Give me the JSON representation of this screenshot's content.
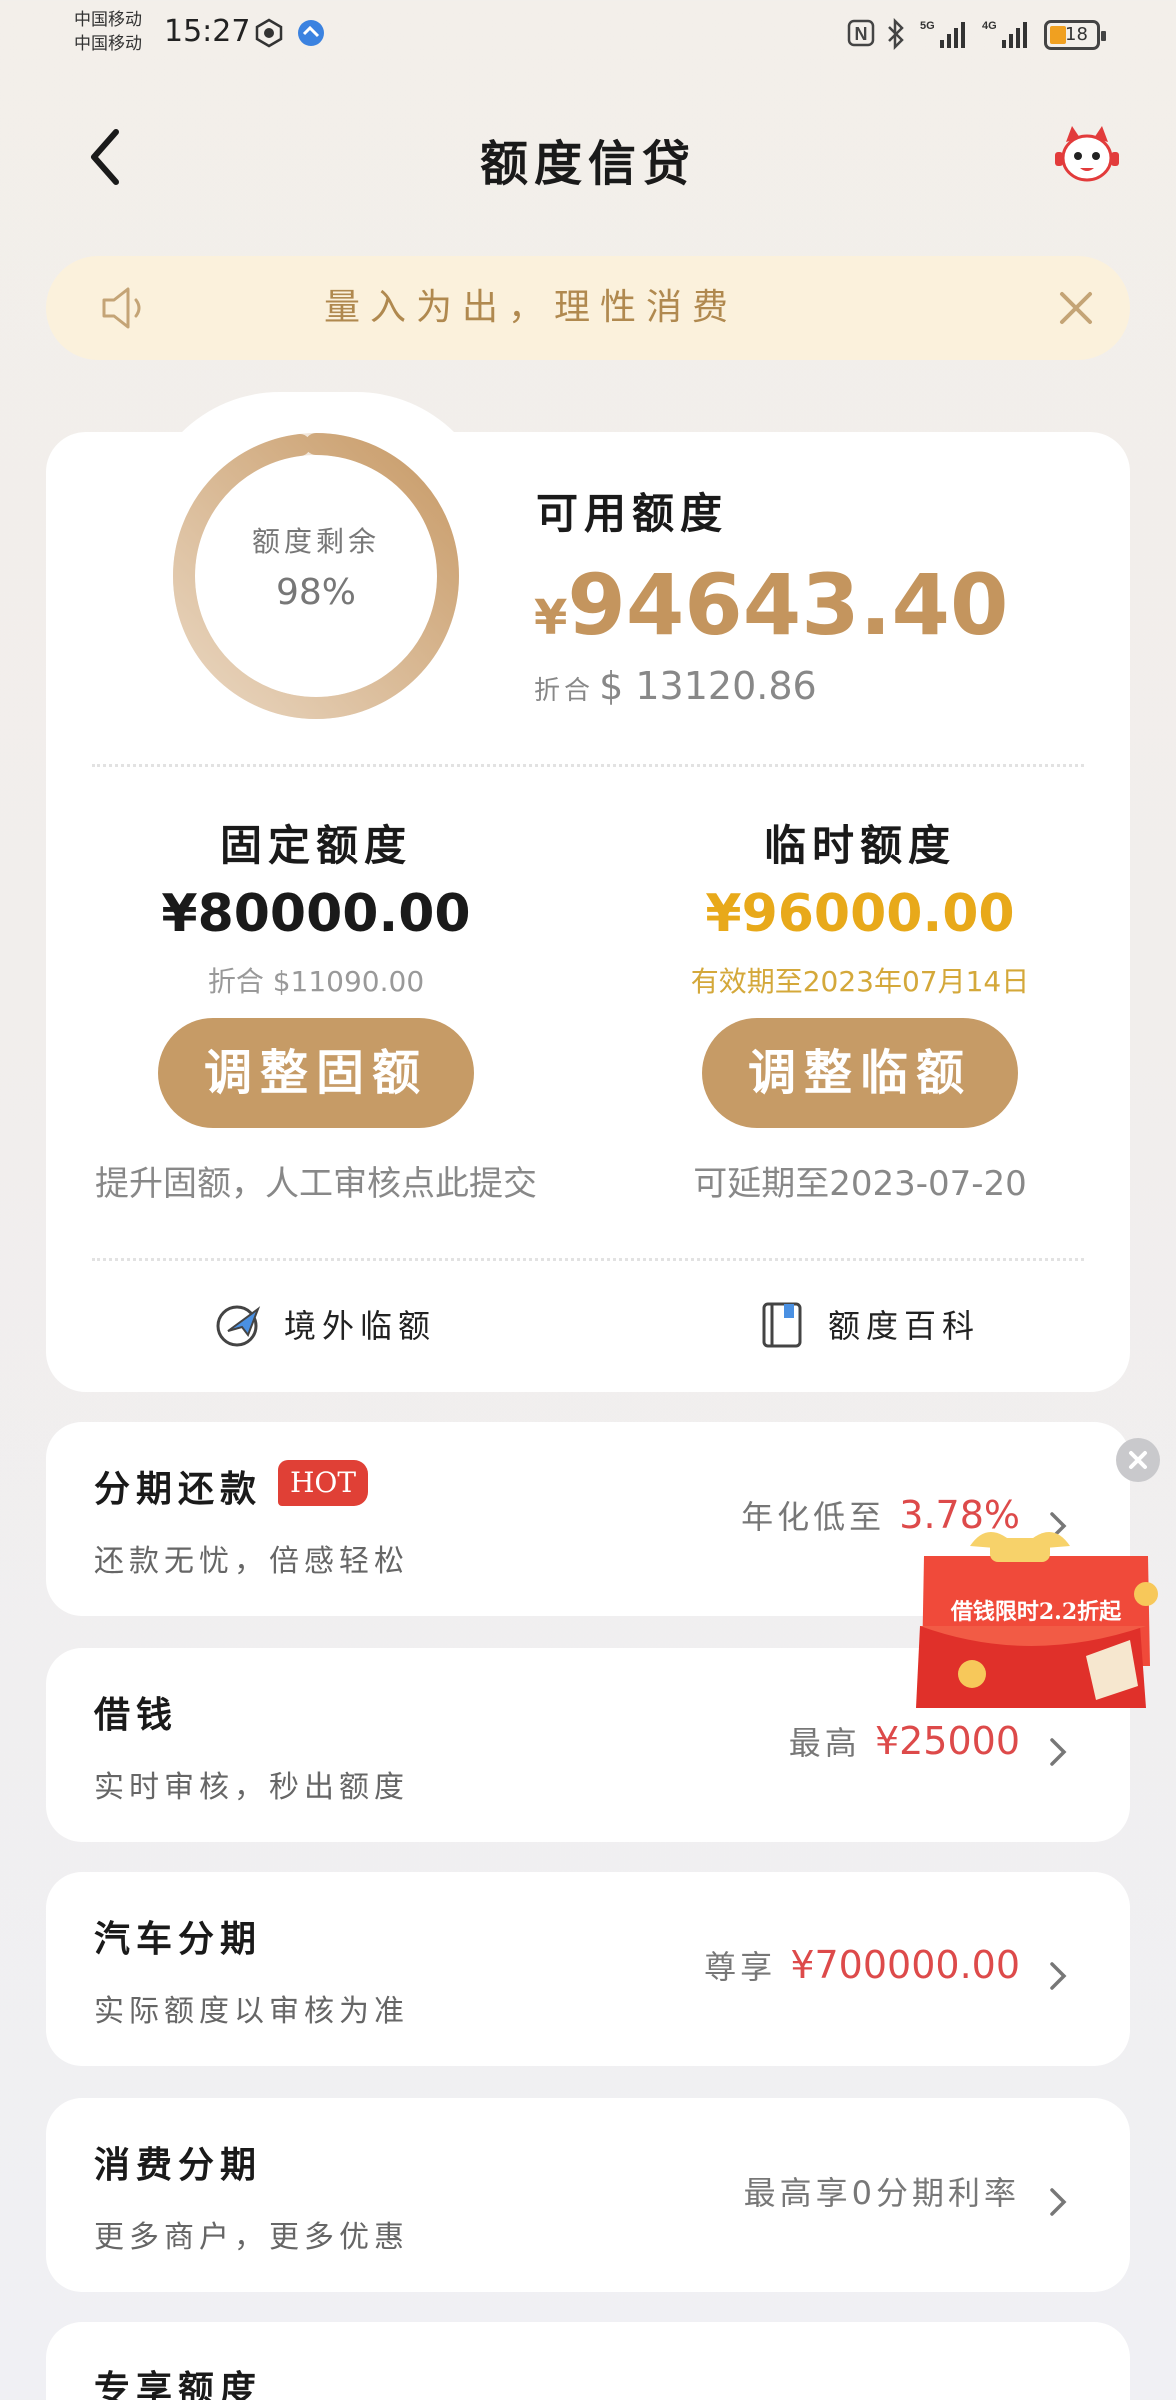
{
  "status_bar": {
    "carrier1": "中国移动",
    "carrier2": "中国移动",
    "time": "15:27",
    "battery": "18"
  },
  "header": {
    "title": "额度信贷"
  },
  "notice": {
    "text": "量入为出，理性消费"
  },
  "credit": {
    "ring_label": "额度剩余",
    "ring_value": "98%",
    "remaining_fraction": 0.98,
    "available_label": "可用额度",
    "currency": "¥",
    "available_amount": "94643.40",
    "usd_prefix": "折合",
    "usd_amount": "$ 13120.86"
  },
  "fixed": {
    "title": "固定额度",
    "amount": "¥80000.00",
    "sub": "折合 $11090.00",
    "button": "调整固额",
    "hint": "提升固额，人工审核点此提交"
  },
  "temp": {
    "title": "临时额度",
    "amount": "¥96000.00",
    "sub": "有效期至2023年07月14日",
    "button": "调整临额",
    "hint": "可延期至2023-07-20"
  },
  "links": {
    "overseas": "境外临额",
    "wiki": "额度百科"
  },
  "cards": [
    {
      "title": "分期还款",
      "badge": "HOT",
      "subtitle": "还款无忧，倍感轻松",
      "right_prefix": "年化低至 ",
      "right_value": "3.78%"
    },
    {
      "title": "借钱",
      "subtitle": "实时审核，秒出额度",
      "right_prefix": "最高 ",
      "right_value": "¥25000"
    },
    {
      "title": "汽车分期",
      "subtitle": "实际额度以审核为准",
      "right_prefix": "尊享 ",
      "right_value": "¥700000.00"
    },
    {
      "title": "消费分期",
      "subtitle": "更多商户，更多优惠",
      "right_prefix": "最高享0分期利率",
      "right_value": ""
    },
    {
      "title": "专享额度"
    }
  ],
  "promo": {
    "text": "借钱限时2.2折起"
  },
  "colors": {
    "gold": "#c4955e",
    "button": "#c69b66",
    "temp_amount": "#e8a91a",
    "highlight_red": "#dd4a4a",
    "notice_bg": "#fbf1dc"
  }
}
